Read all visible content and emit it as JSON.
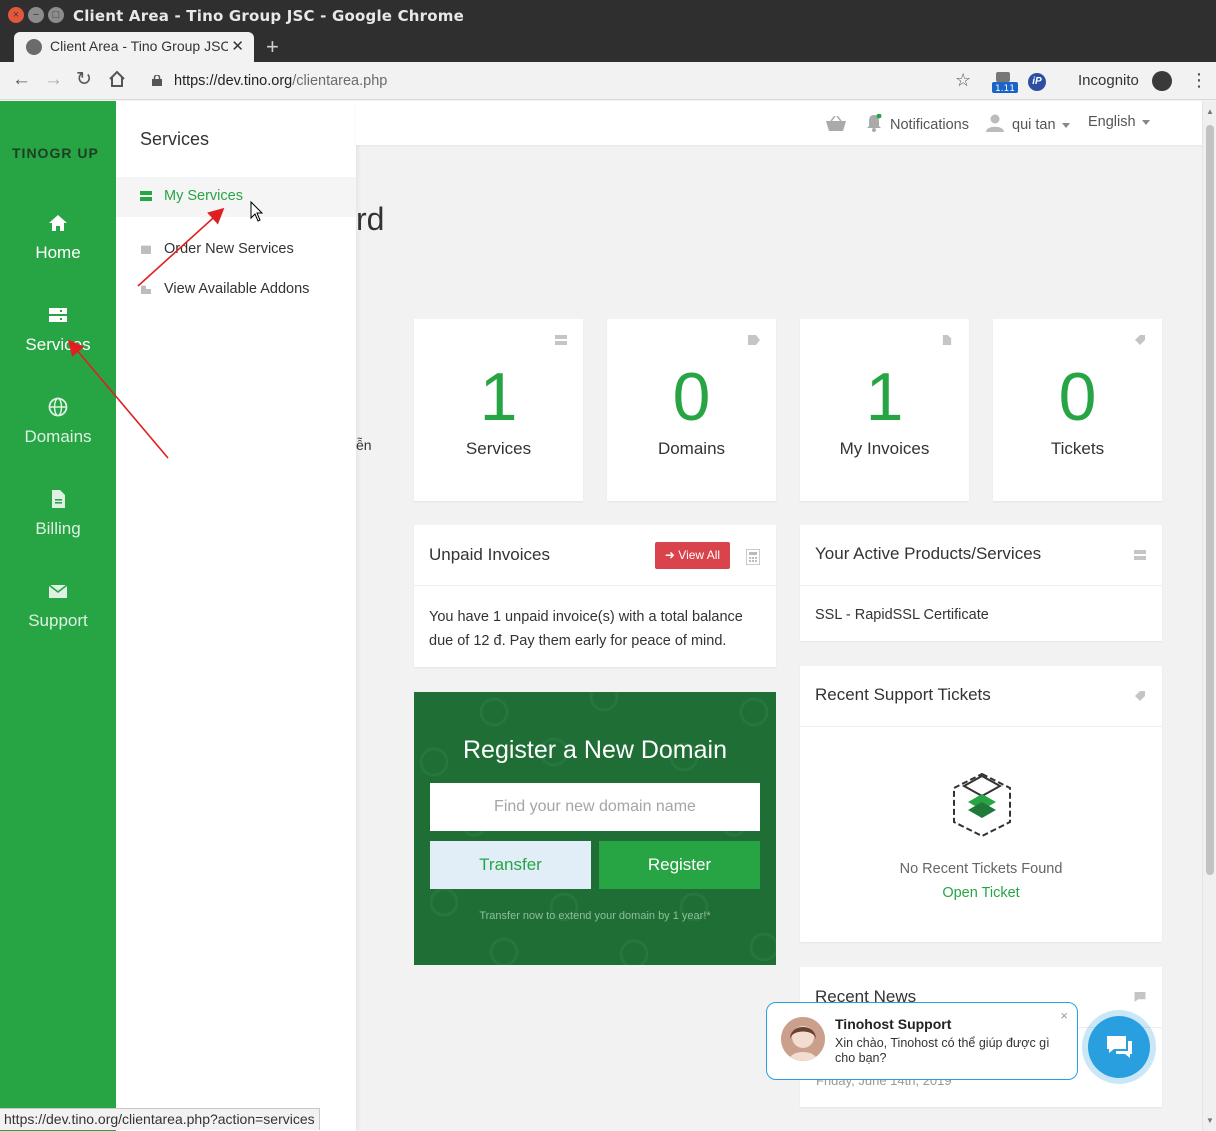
{
  "window": {
    "title": "Client Area - Tino Group JSC - Google Chrome"
  },
  "tab": {
    "title": "Client Area - Tino Group JSC",
    "close": "✕",
    "new_tab": "+"
  },
  "toolbar": {
    "url_host": "https://dev.tino.org",
    "url_path": "/clientarea.php",
    "extension_badge": "1.11",
    "ip_ext": "iP",
    "incognito_label": "Incognito"
  },
  "sidebar": {
    "logo": "TINOGR UP",
    "items": [
      {
        "label": "Home",
        "icon": "home-icon"
      },
      {
        "label": "Services",
        "icon": "server-icon"
      },
      {
        "label": "Domains",
        "icon": "globe-icon"
      },
      {
        "label": "Billing",
        "icon": "document-icon"
      },
      {
        "label": "Support",
        "icon": "envelope-icon"
      }
    ]
  },
  "flyout": {
    "title": "Services",
    "items": [
      {
        "label": "My Services",
        "active": true
      },
      {
        "label": "Order New Services",
        "active": false
      },
      {
        "label": "View Available Addons",
        "active": false
      }
    ]
  },
  "topbar": {
    "notifications": "Notifications",
    "user": "qui tan",
    "language": "English"
  },
  "page": {
    "heading_fragment": "rd",
    "text_fragment": "ễn"
  },
  "stats": [
    {
      "value": "1",
      "label": "Services"
    },
    {
      "value": "0",
      "label": "Domains"
    },
    {
      "value": "1",
      "label": "My Invoices"
    },
    {
      "value": "0",
      "label": "Tickets"
    }
  ],
  "unpaid": {
    "title": "Unpaid Invoices",
    "view_all": "View All",
    "body": "You have 1 unpaid invoice(s) with a total balance due of 12 đ. Pay them early for peace of mind."
  },
  "domain_register": {
    "title": "Register a New Domain",
    "placeholder": "Find your new domain name",
    "transfer": "Transfer",
    "register": "Register",
    "note": "Transfer now to extend your domain by 1 year!*"
  },
  "active_products": {
    "title": "Your Active Products/Services",
    "item": "SSL - RapidSSL Certificate"
  },
  "support_tickets": {
    "title": "Recent Support Tickets",
    "empty": "No Recent Tickets Found",
    "open": "Open Ticket"
  },
  "news": {
    "title": "Recent News",
    "date": "Friday, June 14th, 2019"
  },
  "chat": {
    "name": "Tinohost Support",
    "message": "Xin chào, Tinohost có thể giúp được gì cho bạn?",
    "close": "×"
  },
  "status_bar": {
    "url": "https://dev.tino.org/clientarea.php?action=services"
  },
  "colors": {
    "brand_green": "#27a544",
    "dark_green": "#1e6e35",
    "danger_red": "#d9434b",
    "chat_blue": "#2a9fe0",
    "annotation_red": "#e02020"
  }
}
